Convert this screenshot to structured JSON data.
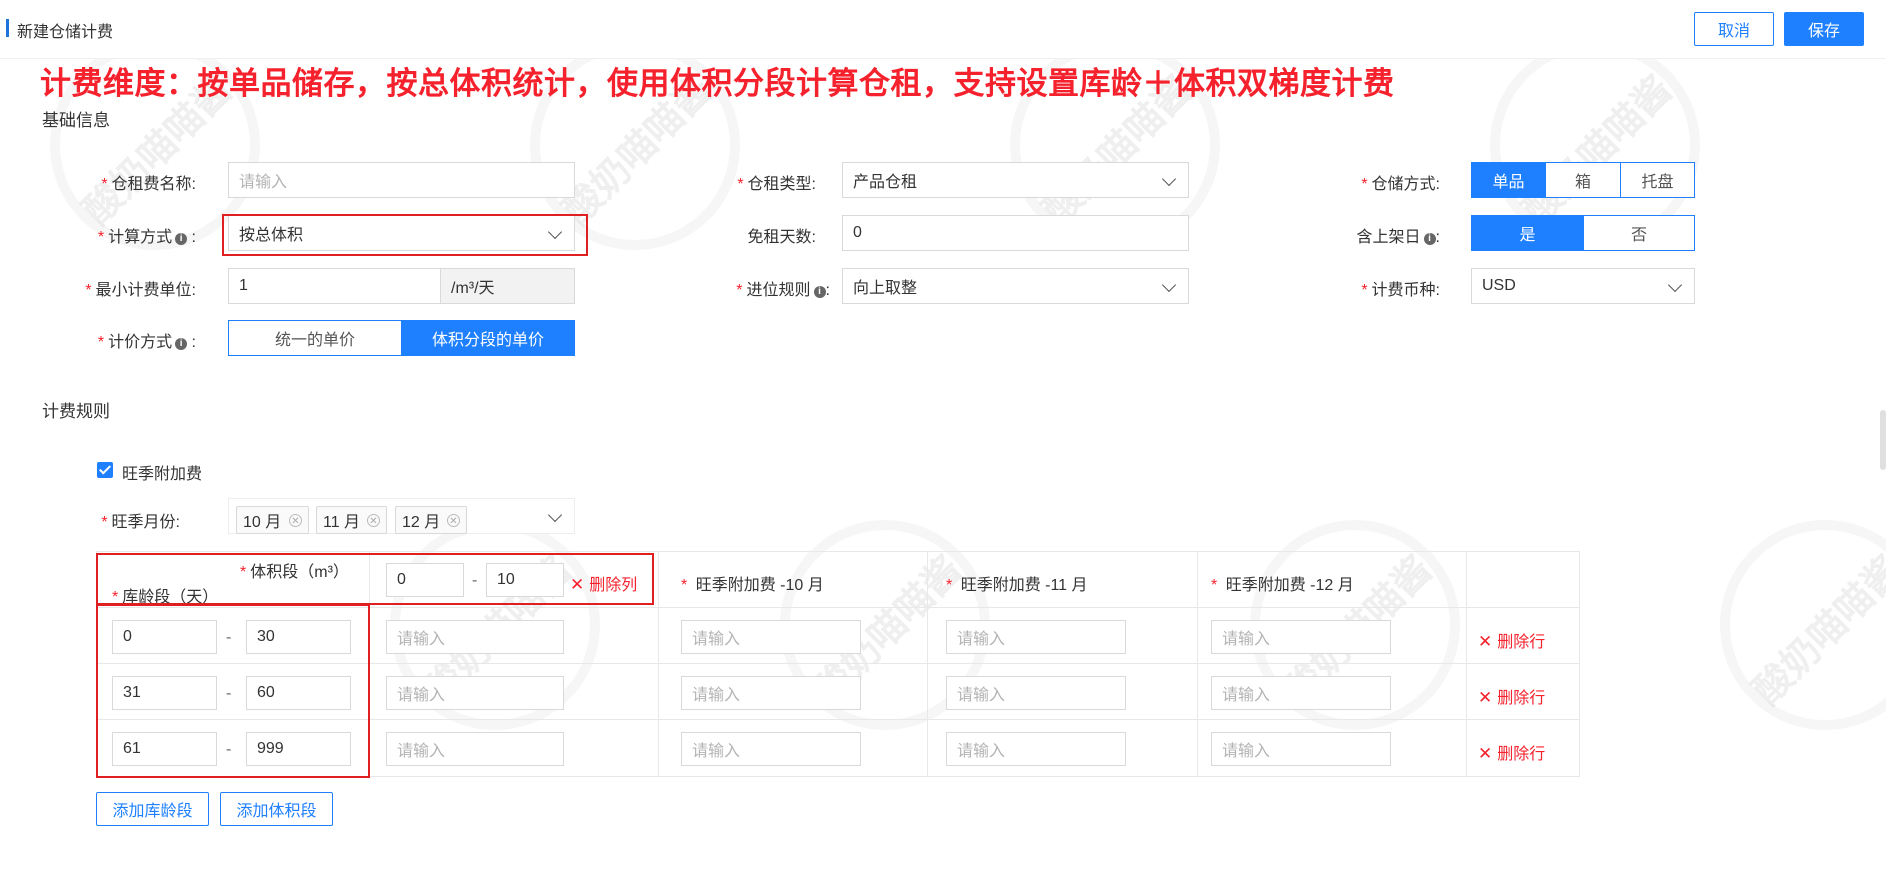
{
  "header": {
    "title": "新建仓储计费",
    "cancel_label": "取消",
    "save_label": "保存"
  },
  "banner": "计费维度：按单品储存，按总体积统计，使用体积分段计算仓租，支持设置库龄＋体积双梯度计费",
  "watermark": "酸奶喵喵酱",
  "basic": {
    "section_title": "基础信息",
    "name": {
      "label": "仓租费名称:",
      "placeholder": "请输入"
    },
    "calc_method": {
      "label": "计算方式",
      "value": "按总体积"
    },
    "min_unit": {
      "label": "最小计费单位:",
      "value": "1",
      "suffix": "/m³/天"
    },
    "pricing": {
      "label": "计价方式",
      "options": [
        "统一的单价",
        "体积分段的单价"
      ],
      "selected": "体积分段的单价"
    },
    "rent_type": {
      "label": "仓租类型:",
      "value": "产品仓租"
    },
    "free_days": {
      "label": "免租天数:",
      "value": "0"
    },
    "rounding": {
      "label": "进位规则",
      "value": "向上取整"
    },
    "storage_mode": {
      "label": "仓储方式:",
      "options": [
        "单品",
        "箱",
        "托盘"
      ],
      "selected": "单品"
    },
    "include_shelving_day": {
      "label": "含上架日",
      "options": [
        "是",
        "否"
      ],
      "selected": "是"
    },
    "currency": {
      "label": "计费币种:",
      "value": "USD"
    }
  },
  "rules": {
    "section_title": "计费规则",
    "peak_surcharge": {
      "label": "旺季附加费",
      "checked": true
    },
    "peak_months": {
      "label": "旺季月份:",
      "tags": [
        "10 月",
        "11 月",
        "12 月"
      ]
    },
    "table": {
      "corner_volume": "体积段（m³）",
      "corner_age": "库龄段（天）",
      "volume_from": "0",
      "volume_to": "10",
      "delete_col": "删除列",
      "peak_cols": [
        "旺季附加费 -10 月",
        "旺季附加费 -11 月",
        "旺季附加费 -12 月"
      ],
      "cell_placeholder": "请输入",
      "delete_row": "删除行",
      "rows": [
        {
          "from": "0",
          "to": "30"
        },
        {
          "from": "31",
          "to": "60"
        },
        {
          "from": "61",
          "to": "999"
        }
      ]
    },
    "add_age_label": "添加库龄段",
    "add_volume_label": "添加体积段"
  }
}
